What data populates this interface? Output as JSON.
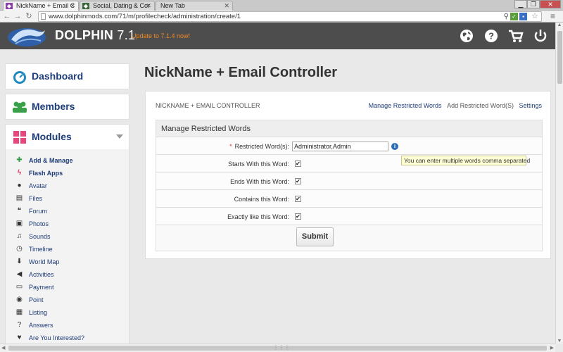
{
  "browser": {
    "tabs": [
      {
        "title": "NickName + Email C",
        "active": true
      },
      {
        "title": "Social, Dating & Cor",
        "active": false
      },
      {
        "title": "New Tab",
        "active": false
      }
    ],
    "url": "www.dolphinmods.com/71/m/profilecheck/administration/create/1"
  },
  "header": {
    "brand_name": "DOLPHIN",
    "brand_version": "7.1",
    "update_notice": "Update to 7.1.4 now!",
    "icons": [
      "globe-icon",
      "help-icon",
      "cart-icon",
      "power-icon"
    ]
  },
  "sidebar": {
    "dashboard": "Dashboard",
    "members": "Members",
    "modules": "Modules",
    "module_items": [
      {
        "label": "Add & Manage",
        "icon": "plus-icon",
        "bold": true
      },
      {
        "label": "Flash Apps",
        "icon": "flash-icon",
        "bold": true
      },
      {
        "label": "Avatar",
        "icon": "user-icon",
        "bold": false
      },
      {
        "label": "Files",
        "icon": "file-icon",
        "bold": false
      },
      {
        "label": "Forum",
        "icon": "comments-icon",
        "bold": false
      },
      {
        "label": "Photos",
        "icon": "photo-icon",
        "bold": false
      },
      {
        "label": "Sounds",
        "icon": "music-icon",
        "bold": false
      },
      {
        "label": "Timeline",
        "icon": "clock-icon",
        "bold": false
      },
      {
        "label": "World Map",
        "icon": "map-marker-icon",
        "bold": false
      },
      {
        "label": "Activities",
        "icon": "bullhorn-icon",
        "bold": false
      },
      {
        "label": "Payment",
        "icon": "credit-card-icon",
        "bold": false
      },
      {
        "label": "Point",
        "icon": "point-icon",
        "bold": false
      },
      {
        "label": "Listing",
        "icon": "briefcase-icon",
        "bold": false
      },
      {
        "label": "Answers",
        "icon": "question-icon",
        "bold": false
      },
      {
        "label": "Are You Interested?",
        "icon": "heart-icon",
        "bold": false
      }
    ]
  },
  "main": {
    "page_title": "NickName + Email Controller",
    "card_title": "NICKNAME + EMAIL CONTROLLER",
    "links": {
      "manage": "Manage Restricted Words",
      "add": "Add Restricted Word(S)",
      "settings": "Settings"
    },
    "form": {
      "section_title": "Manage Restricted Words",
      "restricted_label": "Restricted Word(s):",
      "required_mark": "*",
      "restricted_value": "Administrator,Admin",
      "tooltip": "You can enter multiple words comma separated",
      "starts_label": "Starts With this Word:",
      "ends_label": "Ends With this Word:",
      "contains_label": "Contains this Word:",
      "exact_label": "Exactly like this Word:",
      "checked_mark": "✔",
      "submit_label": "Submit"
    }
  }
}
